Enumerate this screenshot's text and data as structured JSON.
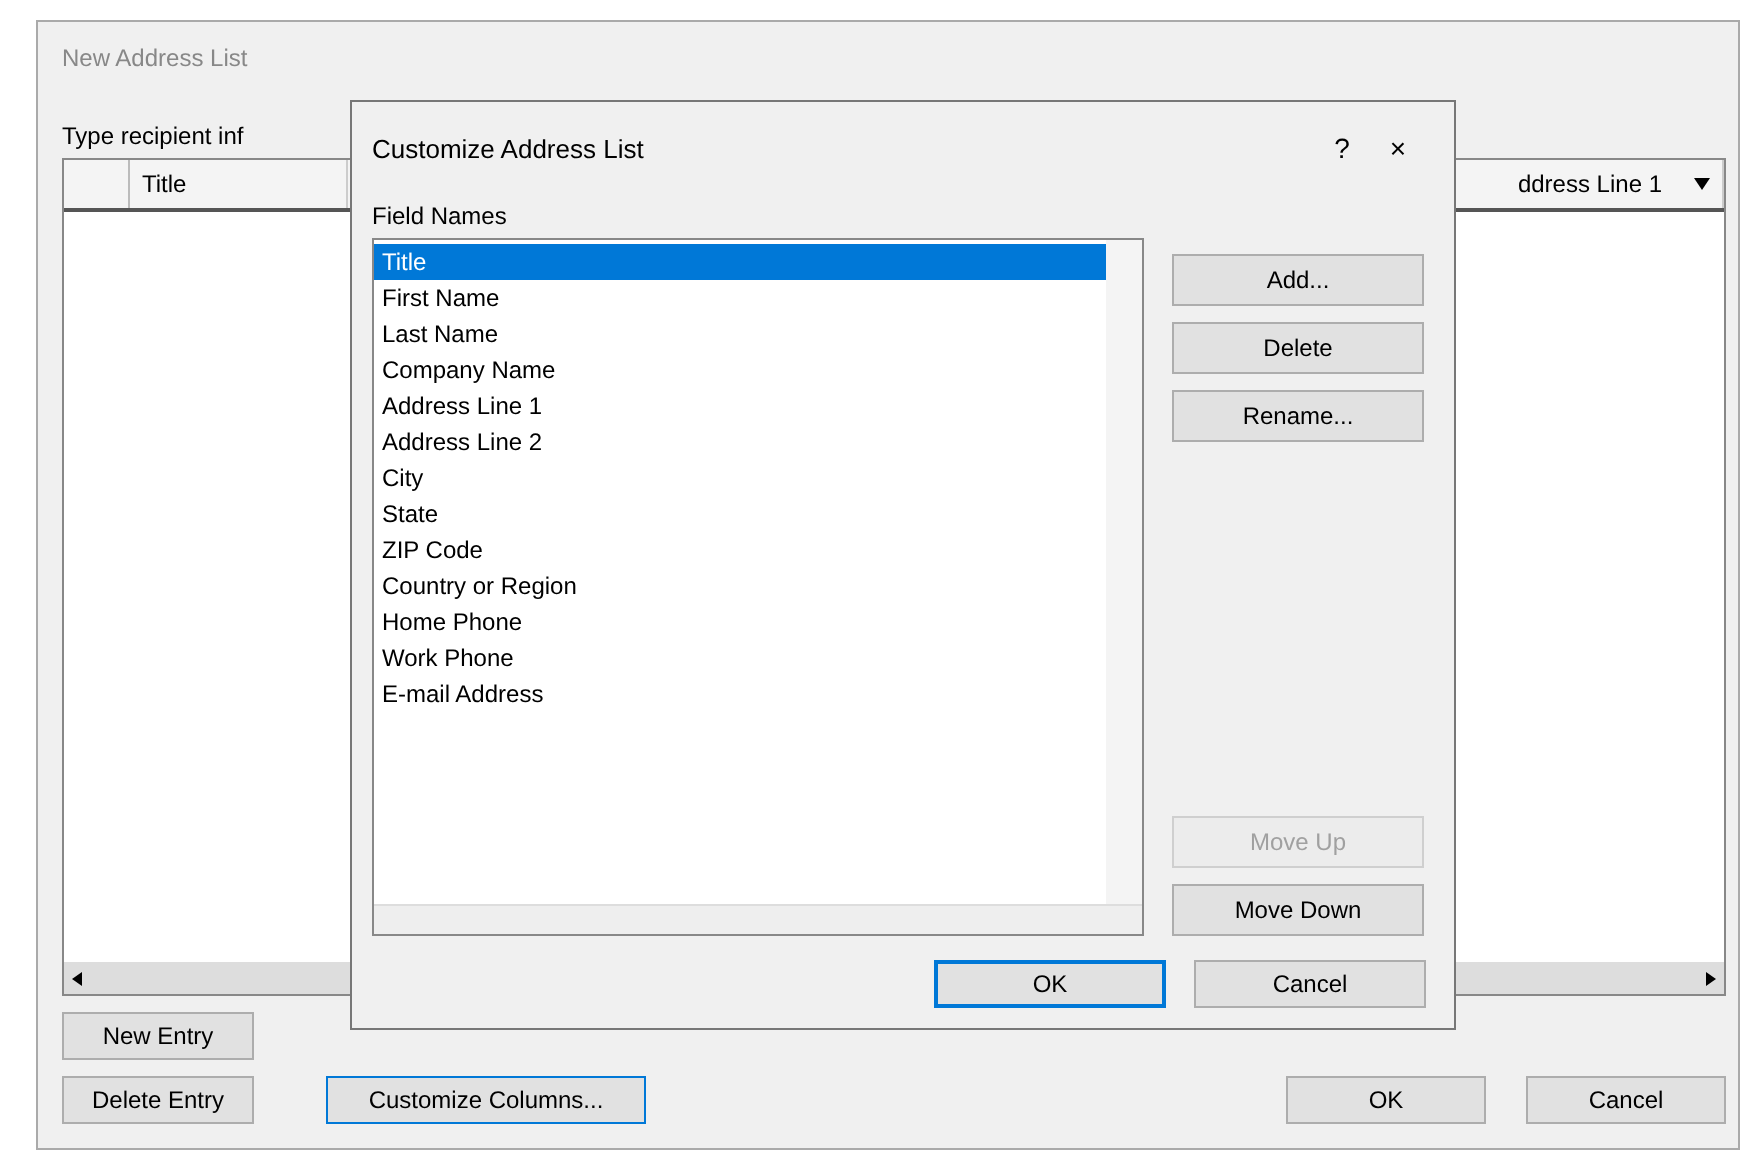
{
  "main_window": {
    "title": "New Address List",
    "instruction": "Type recipient inf",
    "table": {
      "columns": [
        {
          "label": "Title",
          "dropdown": false
        },
        {
          "label": "ddress Line 1",
          "dropdown": true
        }
      ]
    },
    "buttons_left": [
      "New Entry",
      "Delete Entry"
    ],
    "customize_button": "Customize Columns...",
    "buttons_right": [
      "OK",
      "Cancel"
    ]
  },
  "dialog": {
    "title": "Customize Address List",
    "help": "?",
    "close": "×",
    "list_label": "Field Names",
    "fields": [
      {
        "label": "Title",
        "selected": true
      },
      {
        "label": "First Name",
        "selected": false
      },
      {
        "label": "Last Name",
        "selected": false
      },
      {
        "label": "Company Name",
        "selected": false
      },
      {
        "label": "Address Line 1",
        "selected": false
      },
      {
        "label": "Address Line 2",
        "selected": false
      },
      {
        "label": "City",
        "selected": false
      },
      {
        "label": "State",
        "selected": false
      },
      {
        "label": "ZIP Code",
        "selected": false
      },
      {
        "label": "Country or Region",
        "selected": false
      },
      {
        "label": "Home Phone",
        "selected": false
      },
      {
        "label": "Work Phone",
        "selected": false
      },
      {
        "label": "E-mail Address",
        "selected": false
      }
    ],
    "side_buttons": [
      {
        "label": "Add...",
        "disabled": false
      },
      {
        "label": "Delete",
        "disabled": false
      },
      {
        "label": "Rename...",
        "disabled": false
      },
      {
        "label": "Move Up",
        "disabled": true
      },
      {
        "label": "Move Down",
        "disabled": false
      }
    ],
    "footer_buttons": [
      {
        "label": "OK",
        "default": true
      },
      {
        "label": "Cancel",
        "default": false
      }
    ]
  }
}
